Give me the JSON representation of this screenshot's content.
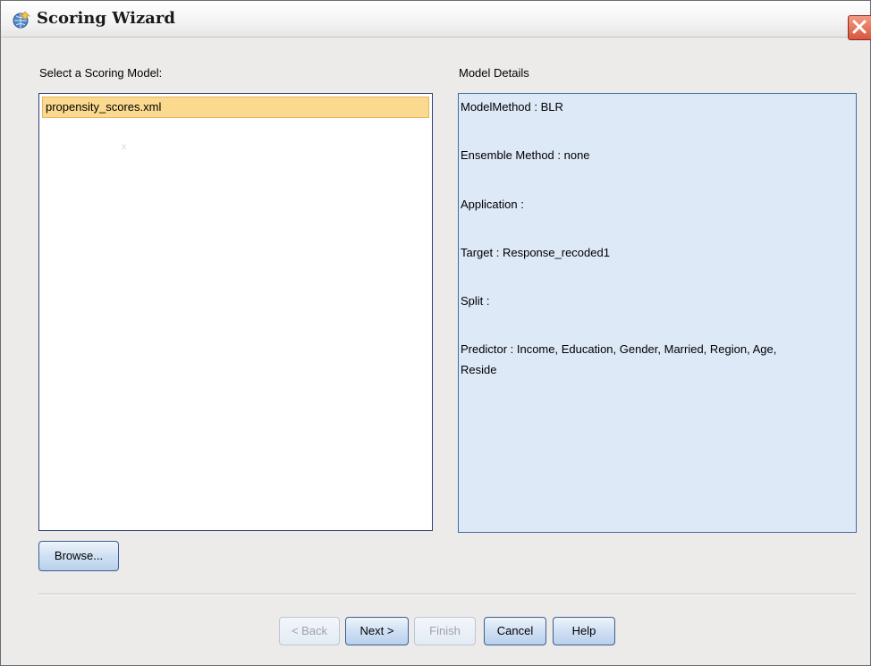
{
  "window": {
    "title": "Scoring Wizard"
  },
  "left_panel": {
    "label": "Select a Scoring Model:",
    "items": [
      "propensity_scores.xml"
    ],
    "stray_mark": "x"
  },
  "right_panel": {
    "label": "Model Details",
    "lines": [
      "ModelMethod : BLR",
      "Ensemble Method : none",
      "Application :",
      "Target : Response_recoded1",
      "Split :",
      "Predictor : Income, Education, Gender, Married, Region, Age,",
      "Reside"
    ]
  },
  "buttons": {
    "browse": "Browse...",
    "back": "< Back",
    "next": "Next >",
    "finish": "Finish",
    "cancel": "Cancel",
    "help": "Help"
  },
  "colors": {
    "selection": "#fbd98e",
    "details_background": "#dde9f7",
    "button": "#cfe0f3",
    "close_button": "#d8563c"
  },
  "icons": {
    "app": "globe-icon",
    "close": "close-icon"
  }
}
